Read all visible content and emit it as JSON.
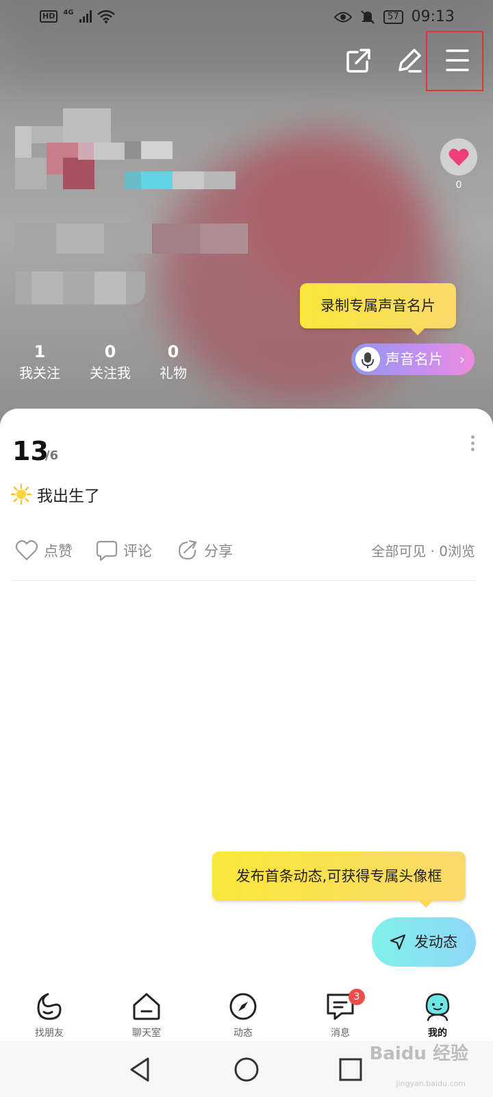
{
  "status_bar": {
    "hd": "HD",
    "network": "4G",
    "battery": "57",
    "time": "09:13"
  },
  "header": {
    "share_icon": "share-icon",
    "edit_icon": "edit-icon",
    "menu_icon": "menu-icon",
    "like_count": "0",
    "voice_tooltip": "录制专属声音名片",
    "voice_card_label": "声音名片",
    "voice_card_chevron": "›",
    "stats": [
      {
        "value": "1",
        "label": "我关注"
      },
      {
        "value": "0",
        "label": "关注我"
      },
      {
        "value": "0",
        "label": "礼物"
      }
    ]
  },
  "post": {
    "day": "13",
    "month": "/6",
    "emoji": "sun-emoji",
    "text": "我出生了",
    "actions": {
      "like": "点赞",
      "comment": "评论",
      "share": "分享"
    },
    "visibility": "全部可见 · 0浏览"
  },
  "publish": {
    "tooltip": "发布首条动态,可获得专属头像框",
    "button_label": "发动态"
  },
  "tabbar": {
    "items": [
      {
        "label": "找朋友",
        "icon": "moon-icon"
      },
      {
        "label": "聊天室",
        "icon": "house-icon"
      },
      {
        "label": "动态",
        "icon": "compass-icon"
      },
      {
        "label": "消息",
        "icon": "chat-icon",
        "badge": "3"
      },
      {
        "label": "我的",
        "icon": "profile-face-icon"
      }
    ]
  },
  "watermark": {
    "main": "Baidu 经验",
    "sub": "jingyan.baidu.com"
  },
  "colors": {
    "accent_yellow": "#f9e63a",
    "fab_cyan": "#7ff0ea",
    "badge_red": "#ef4c4c",
    "heart_pink": "#ef3f7a"
  }
}
